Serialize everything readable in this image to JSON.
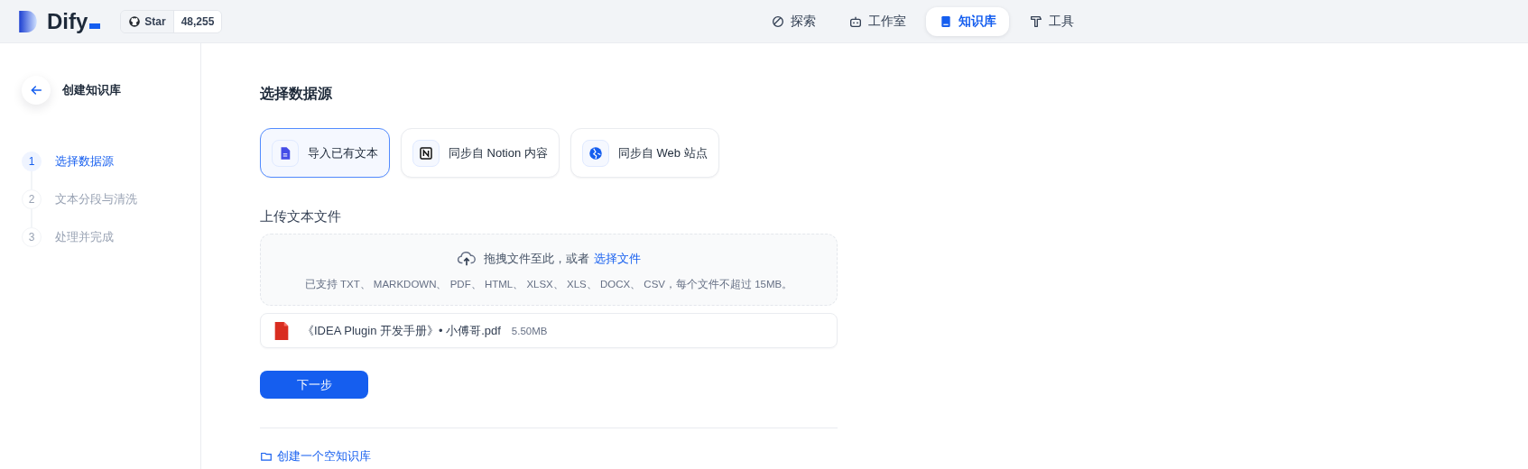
{
  "brand": {
    "name": "Dify",
    "github": {
      "label": "Star",
      "count": "48,255"
    }
  },
  "nav": [
    {
      "label": "探索",
      "selected": false
    },
    {
      "label": "工作室",
      "selected": false
    },
    {
      "label": "知识库",
      "selected": true
    },
    {
      "label": "工具",
      "selected": false
    }
  ],
  "sidebar": {
    "title": "创建知识库",
    "steps": [
      {
        "number": "1",
        "label": "选择数据源",
        "selected": true
      },
      {
        "number": "2",
        "label": "文本分段与清洗",
        "selected": false
      },
      {
        "number": "3",
        "label": "处理并完成",
        "selected": false
      }
    ]
  },
  "main": {
    "heading": "选择数据源",
    "sources": [
      {
        "label": "导入已有文本",
        "selected": true
      },
      {
        "label": "同步自 Notion 内容",
        "selected": false
      },
      {
        "label": "同步自 Web 站点",
        "selected": false
      }
    ],
    "upload": {
      "heading": "上传文本文件",
      "prompt": "拖拽文件至此，或者",
      "link": "选择文件",
      "hint": "已支持 TXT、 MARKDOWN、 PDF、 HTML、 XLSX、 XLS、 DOCX、 CSV，每个文件不超过 15MB。"
    },
    "files": [
      {
        "name": "《IDEA Plugin 开发手册》• 小傅哥.pdf",
        "size": "5.50MB"
      }
    ],
    "next_button": "下一步",
    "empty_link": "创建一个空知识库"
  }
}
